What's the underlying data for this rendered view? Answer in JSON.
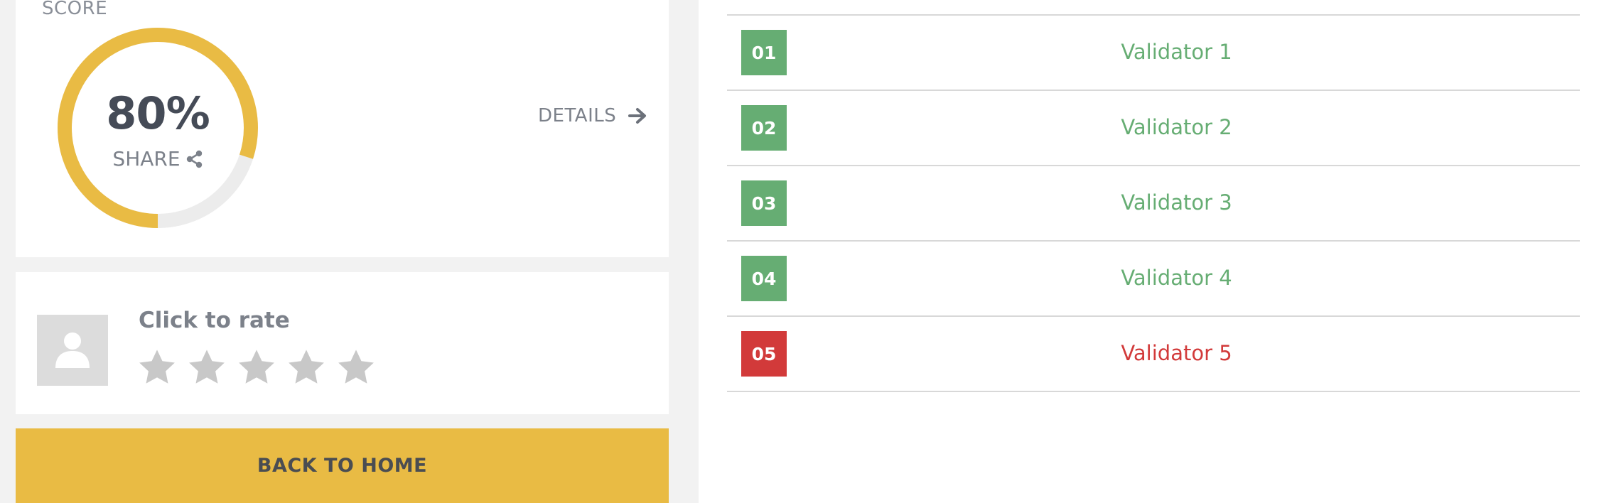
{
  "score": {
    "label": "SCORE",
    "value_text": "80%",
    "percent": 80,
    "share_label": "SHARE",
    "details_label": "DETAILS",
    "accent_color": "#e9bb44",
    "track_color": "#ececec"
  },
  "rating": {
    "label": "Click to rate",
    "max_stars": 5,
    "selected": 0,
    "star_color": "#c8c8c8"
  },
  "back_home": {
    "label": "BACK TO HOME"
  },
  "validators": [
    {
      "number": "01",
      "name": "Validator 1",
      "status": "pass"
    },
    {
      "number": "02",
      "name": "Validator 2",
      "status": "pass"
    },
    {
      "number": "03",
      "name": "Validator 3",
      "status": "pass"
    },
    {
      "number": "04",
      "name": "Validator 4",
      "status": "pass"
    },
    {
      "number": "05",
      "name": "Validator 5",
      "status": "fail"
    }
  ],
  "status_colors": {
    "pass": "#66ad73",
    "fail": "#d23a3a"
  },
  "icons": {
    "share": "share-icon",
    "details": "arrow-right-icon",
    "avatar": "user-icon",
    "star": "star-icon"
  }
}
